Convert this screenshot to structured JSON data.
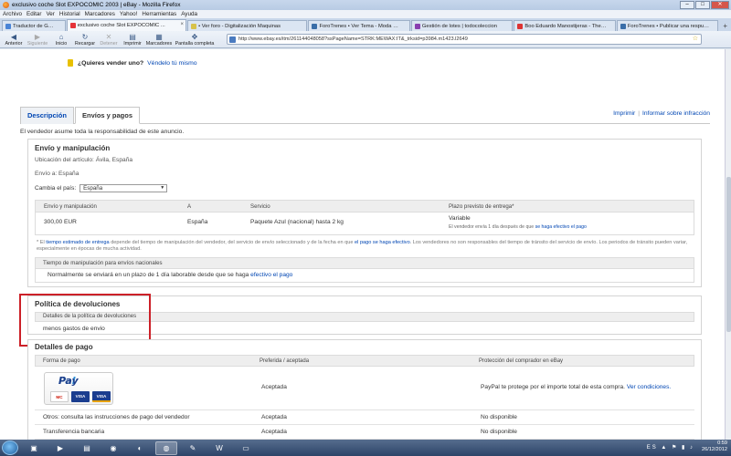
{
  "window": {
    "title": "exclusivo coche Slot EXPOCOMIC 2003 | eBay - Mozilla Firefox",
    "buttons": {
      "minimize": "–",
      "maximize": "□",
      "close": "✕"
    }
  },
  "menu": [
    "Archivo",
    "Editar",
    "Ver",
    "Historial",
    "Marcadores",
    "Yahoo!",
    "Herramientas",
    "Ayuda"
  ],
  "tabs": [
    {
      "label": "Traductor de Google",
      "color": "#4a84d6",
      "active": false
    },
    {
      "label": "exclusivo coche Slot EXPOCOMIC ...",
      "color": "#e53238",
      "active": true
    },
    {
      "label": "• Ver foro - Digitalización Maquinas",
      "color": "#d7c24a",
      "active": false
    },
    {
      "label": "ForoTrenes • Ver Tema - Moda mo...",
      "color": "#3a6ea8",
      "active": false
    },
    {
      "label": "Gestión de lotes | todocoleccion",
      "color": "#8a3fb0",
      "active": false
    },
    {
      "label": "Boo Eduardo Manostijeras - The Gr...",
      "color": "#d33",
      "active": false
    },
    {
      "label": "ForoTrenes • Publicar una respuesta",
      "color": "#3a6ea8",
      "active": false
    }
  ],
  "newtab_label": "+",
  "nav": {
    "back": "Anterior",
    "forward": "Siguiente",
    "home": "Inicio",
    "reload": "Recargar",
    "stop": "Detener",
    "print": "Imprimir",
    "bookmarks": "Marcadores",
    "fullscreen": "Pantalla completa",
    "url": "http://www.ebay.es/itm/261144048058?ssPageName=STRK:MEWAX:IT&_trksid=p3984.m1423.l2649"
  },
  "page": {
    "sell_question": "¿Quieres vender uno?",
    "sell_link": "Véndelo tú mismo",
    "tab_description": "Descripción",
    "tab_shipping": "Envíos y pagos",
    "print_link": "Imprimir",
    "report_link": "Informar sobre infracción",
    "responsibility": "El vendedor asume toda la responsabilidad de este anuncio.",
    "shipping": {
      "title": "Envío y manipulación",
      "location": "Ubicación del artículo: Ávila, España",
      "ships_to": "Envío a: España",
      "country_label": "Cambia el país:",
      "country_value": "España",
      "headers": [
        "Envío y manipulación",
        "A",
        "Servicio",
        "Plazo previsto de entrega*"
      ],
      "row": {
        "cost": "300,00 EUR",
        "to": "España",
        "service": "Paquete Azul (nacional) hasta 2 kg",
        "delivery": "Variable",
        "delivery_note_pre": "El vendedor envía 1 día después de que",
        "delivery_note_link": "se haga efectivo el pago"
      },
      "note_star": "* El",
      "note_link": "tiempo estimado de entrega",
      "note_mid": "depende del tiempo de manipulación del vendedor, del servicio de envío seleccionado y de la fecha en que",
      "note_link2": "el pago se haga efectivo",
      "note_end": ". Los vendedores no son responsables del tiempo de tránsito del servicio de envío. Los periodos de tránsito pueden variar, especialmente en épocas de mucha actividad.",
      "handling_header": "Tiempo de manipulación para envíos nacionales",
      "handling_pre": "Normalmente se enviará en un plazo de 1 día laborable desde que se haga",
      "handling_link": "efectivo el pago"
    },
    "returns": {
      "title": "Política de devoluciones",
      "header": "Detalles de la política de devoluciones",
      "detail": "menos gastos de envio"
    },
    "payment": {
      "title": "Detalles de pago",
      "headers": [
        "Forma de pago",
        "Preferida / aceptada",
        "Protección del comprador en eBay"
      ],
      "paypal_logo": "PayPal",
      "paypal_pay": "Pay",
      "paypal_pal": "Pal",
      "cards": [
        "MasterCard",
        "VISA",
        "VISA"
      ],
      "rows": [
        {
          "method": "",
          "status": "Aceptada",
          "protection": "PayPal te protege por el importe total de esta compra.",
          "protection_link": "Ver condiciones."
        },
        {
          "method": "Otros: consulta las instrucciones de pago del vendedor",
          "status": "Aceptada",
          "protection": "No disponible"
        },
        {
          "method": "Transferencia bancaria",
          "status": "Aceptada",
          "protection": "No disponible"
        }
      ]
    }
  },
  "taskbar": {
    "time": "0:59",
    "date": "26/12/2012",
    "lang": "ES"
  },
  "colors": {
    "highlight_box": "#cc2028",
    "link": "#0046b3"
  }
}
